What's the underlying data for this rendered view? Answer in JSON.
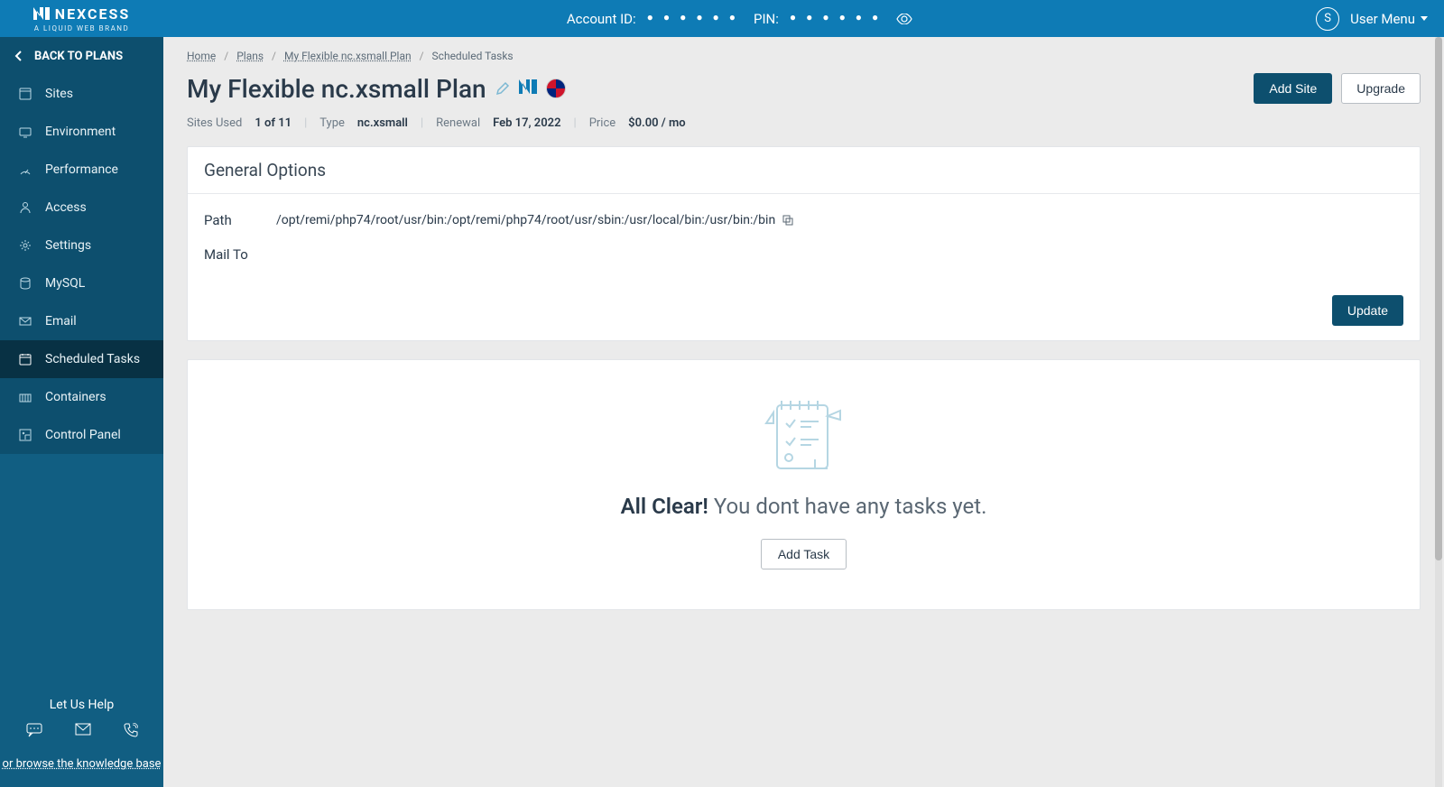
{
  "brand": {
    "name": "NEXCESS",
    "tagline": "A LIQUID WEB BRAND"
  },
  "topbar": {
    "account_id_label": "Account ID:",
    "pin_label": "PIN:",
    "masked": "● ● ● ● ● ●",
    "avatar_initial": "S",
    "user_menu_label": "User Menu"
  },
  "sidebar": {
    "back_label": "BACK TO PLANS",
    "items": [
      {
        "label": "Sites",
        "icon": "sites-icon"
      },
      {
        "label": "Environment",
        "icon": "environment-icon"
      },
      {
        "label": "Performance",
        "icon": "performance-icon"
      },
      {
        "label": "Access",
        "icon": "access-icon"
      },
      {
        "label": "Settings",
        "icon": "settings-icon"
      },
      {
        "label": "MySQL",
        "icon": "database-icon"
      },
      {
        "label": "Email",
        "icon": "email-icon"
      },
      {
        "label": "Scheduled Tasks",
        "icon": "calendar-icon"
      },
      {
        "label": "Containers",
        "icon": "container-icon"
      },
      {
        "label": "Control Panel",
        "icon": "control-panel-icon"
      }
    ],
    "active_index": 7,
    "help_title": "Let Us Help",
    "kb_link": "or browse the knowledge base"
  },
  "breadcrumb": [
    {
      "label": "Home",
      "link": true
    },
    {
      "label": "Plans",
      "link": true
    },
    {
      "label": "My Flexible nc.xsmall Plan",
      "link": true
    },
    {
      "label": "Scheduled Tasks",
      "link": false
    }
  ],
  "page": {
    "title": "My Flexible nc.xsmall Plan",
    "add_site_label": "Add Site",
    "upgrade_label": "Upgrade"
  },
  "meta": {
    "sites_used_label": "Sites Used",
    "sites_used_value": "1 of 11",
    "type_label": "Type",
    "type_value": "nc.xsmall",
    "renewal_label": "Renewal",
    "renewal_value": "Feb 17, 2022",
    "price_label": "Price",
    "price_value": "$0.00 / mo"
  },
  "general_options": {
    "header": "General Options",
    "path_label": "Path",
    "path_value": "/opt/remi/php74/root/usr/bin:/opt/remi/php74/root/usr/sbin:/usr/local/bin:/usr/bin:/bin",
    "mailto_label": "Mail To",
    "mailto_value": "",
    "update_label": "Update"
  },
  "empty_state": {
    "strong": "All Clear!",
    "rest": " You dont have any tasks yet.",
    "add_task_label": "Add Task"
  }
}
